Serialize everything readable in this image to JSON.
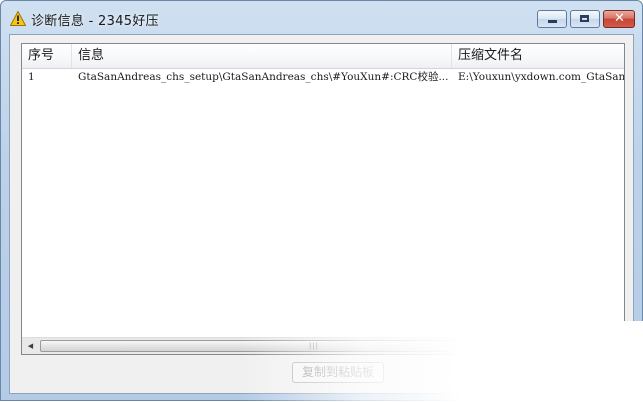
{
  "window": {
    "title": "诊断信息 - 2345好压",
    "title_icon": "warning-icon",
    "controls": {
      "minimize_icon": "minimize-icon",
      "maximize_icon": "maximize-icon",
      "close_icon": "close-icon",
      "close_glyph": "✕"
    }
  },
  "table": {
    "columns": [
      "序号",
      "信息",
      "压缩文件名"
    ],
    "rows": [
      {
        "index": "1",
        "info": "GtaSanAndreas_chs_setup\\GtaSanAndreas_chs\\#YouXun#:CRC校验...",
        "archive": "E:\\Youxun\\yxdown.com_GtaSanAnd"
      }
    ]
  },
  "scrollbar": {
    "left_arrow": "◀",
    "right_arrow": "▶",
    "grip": "|||"
  },
  "buttons": {
    "copy_label": "复制到粘贴板"
  },
  "colors": {
    "titlebar": "#bcd2ea",
    "close_button": "#c4463a",
    "client_background": "#f0f0f0"
  }
}
